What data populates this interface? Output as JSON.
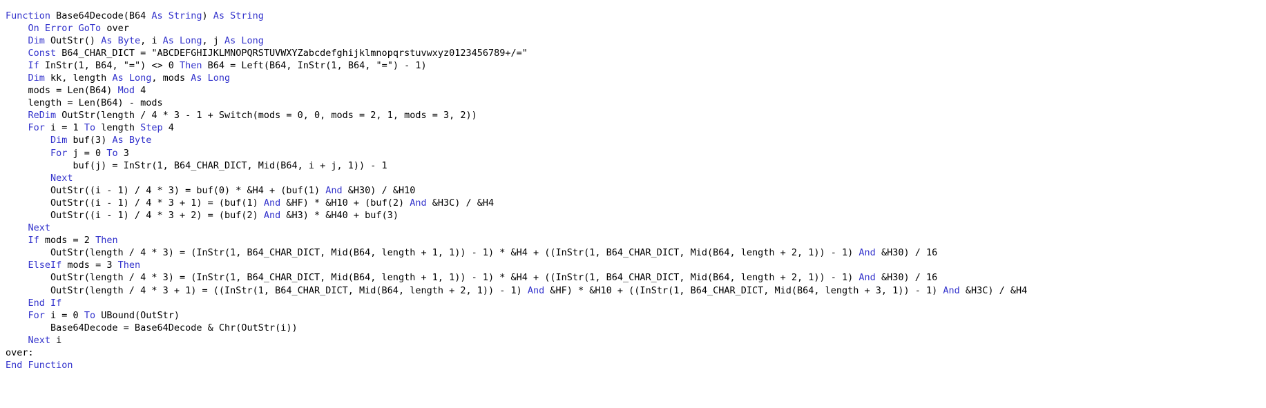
{
  "editor": {
    "language": "VBA",
    "background_color": "#ffffff",
    "plain_color": "#000000",
    "keyword_color": "#3333cc",
    "wrap": false
  },
  "code": {
    "lines": [
      [
        {
          "t": "Function",
          "k": true
        },
        {
          "t": " Base64Decode(B64 ",
          "k": false
        },
        {
          "t": "As String",
          "k": true
        },
        {
          "t": ") ",
          "k": false
        },
        {
          "t": "As String",
          "k": true
        }
      ],
      [
        {
          "t": "    ",
          "k": false
        },
        {
          "t": "On Error GoTo",
          "k": true
        },
        {
          "t": " over",
          "k": false
        }
      ],
      [
        {
          "t": "    ",
          "k": false
        },
        {
          "t": "Dim",
          "k": true
        },
        {
          "t": " OutStr() ",
          "k": false
        },
        {
          "t": "As Byte",
          "k": true
        },
        {
          "t": ", i ",
          "k": false
        },
        {
          "t": "As Long",
          "k": true
        },
        {
          "t": ", j ",
          "k": false
        },
        {
          "t": "As Long",
          "k": true
        }
      ],
      [
        {
          "t": "    ",
          "k": false
        },
        {
          "t": "Const",
          "k": true
        },
        {
          "t": " B64_CHAR_DICT = \"ABCDEFGHIJKLMNOPQRSTUVWXYZabcdefghijklmnopqrstuvwxyz0123456789+/=\"",
          "k": false
        }
      ],
      [
        {
          "t": "    ",
          "k": false
        },
        {
          "t": "If",
          "k": true
        },
        {
          "t": " InStr(1, B64, \"=\") <> 0 ",
          "k": false
        },
        {
          "t": "Then",
          "k": true
        },
        {
          "t": " B64 = Left(B64, InStr(1, B64, \"=\") - 1)",
          "k": false
        }
      ],
      [
        {
          "t": "    ",
          "k": false
        },
        {
          "t": "Dim",
          "k": true
        },
        {
          "t": " kk, length ",
          "k": false
        },
        {
          "t": "As Long",
          "k": true
        },
        {
          "t": ", mods ",
          "k": false
        },
        {
          "t": "As Long",
          "k": true
        }
      ],
      [
        {
          "t": "    mods = Len(B64) ",
          "k": false
        },
        {
          "t": "Mod",
          "k": true
        },
        {
          "t": " 4",
          "k": false
        }
      ],
      [
        {
          "t": "    length = Len(B64) - mods",
          "k": false
        }
      ],
      [
        {
          "t": "    ",
          "k": false
        },
        {
          "t": "ReDim",
          "k": true
        },
        {
          "t": " OutStr(length / 4 * 3 - 1 + Switch(mods = 0, 0, mods = 2, 1, mods = 3, 2))",
          "k": false
        }
      ],
      [
        {
          "t": "    ",
          "k": false
        },
        {
          "t": "For",
          "k": true
        },
        {
          "t": " i = 1 ",
          "k": false
        },
        {
          "t": "To",
          "k": true
        },
        {
          "t": " length ",
          "k": false
        },
        {
          "t": "Step",
          "k": true
        },
        {
          "t": " 4",
          "k": false
        }
      ],
      [
        {
          "t": "        ",
          "k": false
        },
        {
          "t": "Dim",
          "k": true
        },
        {
          "t": " buf(3) ",
          "k": false
        },
        {
          "t": "As Byte",
          "k": true
        }
      ],
      [
        {
          "t": "        ",
          "k": false
        },
        {
          "t": "For",
          "k": true
        },
        {
          "t": " j = 0 ",
          "k": false
        },
        {
          "t": "To",
          "k": true
        },
        {
          "t": " 3",
          "k": false
        }
      ],
      [
        {
          "t": "            buf(j) = InStr(1, B64_CHAR_DICT, Mid(B64, i + j, 1)) - 1",
          "k": false
        }
      ],
      [
        {
          "t": "        ",
          "k": false
        },
        {
          "t": "Next",
          "k": true
        }
      ],
      [
        {
          "t": "        OutStr((i - 1) / 4 * 3) = buf(0) * &H4 + (buf(1) ",
          "k": false
        },
        {
          "t": "And",
          "k": true
        },
        {
          "t": " &H30) / &H10",
          "k": false
        }
      ],
      [
        {
          "t": "        OutStr((i - 1) / 4 * 3 + 1) = (buf(1) ",
          "k": false
        },
        {
          "t": "And",
          "k": true
        },
        {
          "t": " &HF) * &H10 + (buf(2) ",
          "k": false
        },
        {
          "t": "And",
          "k": true
        },
        {
          "t": " &H3C) / &H4",
          "k": false
        }
      ],
      [
        {
          "t": "        OutStr((i - 1) / 4 * 3 + 2) = (buf(2) ",
          "k": false
        },
        {
          "t": "And",
          "k": true
        },
        {
          "t": " &H3) * &H40 + buf(3)",
          "k": false
        }
      ],
      [
        {
          "t": "    ",
          "k": false
        },
        {
          "t": "Next",
          "k": true
        }
      ],
      [
        {
          "t": "    ",
          "k": false
        },
        {
          "t": "If",
          "k": true
        },
        {
          "t": " mods = 2 ",
          "k": false
        },
        {
          "t": "Then",
          "k": true
        }
      ],
      [
        {
          "t": "        OutStr(length / 4 * 3) = (InStr(1, B64_CHAR_DICT, Mid(B64, length + 1, 1)) - 1) * &H4 + ((InStr(1, B64_CHAR_DICT, Mid(B64, length + 2, 1)) - 1) ",
          "k": false
        },
        {
          "t": "And",
          "k": true
        },
        {
          "t": " &H30) / 16",
          "k": false
        }
      ],
      [
        {
          "t": "    ",
          "k": false
        },
        {
          "t": "ElseIf",
          "k": true
        },
        {
          "t": " mods = 3 ",
          "k": false
        },
        {
          "t": "Then",
          "k": true
        }
      ],
      [
        {
          "t": "        OutStr(length / 4 * 3) = (InStr(1, B64_CHAR_DICT, Mid(B64, length + 1, 1)) - 1) * &H4 + ((InStr(1, B64_CHAR_DICT, Mid(B64, length + 2, 1)) - 1) ",
          "k": false
        },
        {
          "t": "And",
          "k": true
        },
        {
          "t": " &H30) / 16",
          "k": false
        }
      ],
      [
        {
          "t": "        OutStr(length / 4 * 3 + 1) = ((InStr(1, B64_CHAR_DICT, Mid(B64, length + 2, 1)) - 1) ",
          "k": false
        },
        {
          "t": "And",
          "k": true
        },
        {
          "t": " &HF) * &H10 + ((InStr(1, B64_CHAR_DICT, Mid(B64, length + 3, 1)) - 1) ",
          "k": false
        },
        {
          "t": "And",
          "k": true
        },
        {
          "t": " &H3C) / &H4",
          "k": false
        }
      ],
      [
        {
          "t": "    ",
          "k": false
        },
        {
          "t": "End If",
          "k": true
        }
      ],
      [
        {
          "t": "    ",
          "k": false
        },
        {
          "t": "For",
          "k": true
        },
        {
          "t": " i = 0 ",
          "k": false
        },
        {
          "t": "To",
          "k": true
        },
        {
          "t": " UBound(OutStr)",
          "k": false
        }
      ],
      [
        {
          "t": "        Base64Decode = Base64Decode & Chr(OutStr(i))",
          "k": false
        }
      ],
      [
        {
          "t": "    ",
          "k": false
        },
        {
          "t": "Next",
          "k": true
        },
        {
          "t": " i",
          "k": false
        }
      ],
      [
        {
          "t": "over:",
          "k": false
        }
      ],
      [
        {
          "t": "End Function",
          "k": true
        }
      ]
    ]
  }
}
